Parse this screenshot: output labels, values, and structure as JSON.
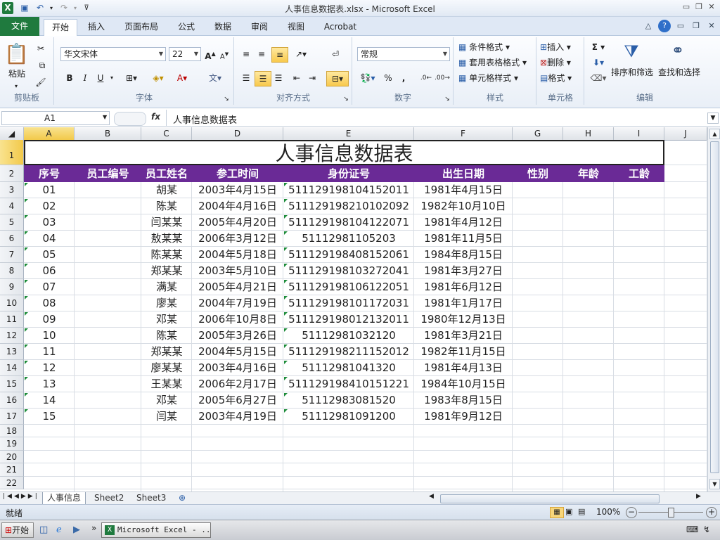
{
  "window": {
    "title": "人事信息数据表.xlsx - Microsoft Excel"
  },
  "tabs": [
    "文件",
    "开始",
    "插入",
    "页面布局",
    "公式",
    "数据",
    "审阅",
    "视图",
    "Acrobat"
  ],
  "ribbon": {
    "clipboard": {
      "label": "剪贴板",
      "paste": "粘贴"
    },
    "font": {
      "label": "字体",
      "name": "华文宋体",
      "size": "22",
      "bold": "B",
      "italic": "I",
      "underline": "U"
    },
    "align": {
      "label": "对齐方式"
    },
    "number": {
      "label": "数字",
      "format": "常规",
      "percent": "%",
      "comma": ","
    },
    "styles": {
      "label": "样式",
      "cond": "条件格式",
      "table": "套用表格格式",
      "cell": "单元格样式"
    },
    "cells": {
      "label": "单元格",
      "insert": "插入",
      "delete": "删除",
      "format": "格式"
    },
    "edit": {
      "label": "编辑",
      "sort": "排序和筛选",
      "find": "查找和选择",
      "sigma": "Σ"
    }
  },
  "formula_bar": {
    "name_box": "A1",
    "fx": "fx",
    "value": "人事信息数据表"
  },
  "sheet": {
    "columns": [
      "A",
      "B",
      "C",
      "D",
      "E",
      "F",
      "G",
      "H",
      "I",
      "J"
    ],
    "title": "人事信息数据表",
    "headers": [
      "序号",
      "员工编号",
      "员工姓名",
      "参工时间",
      "身份证号",
      "出生日期",
      "性别",
      "年龄",
      "工龄"
    ],
    "rows": [
      [
        "01",
        "",
        "胡某",
        "2003年4月15日",
        "511129198104152011",
        "1981年4月15日"
      ],
      [
        "02",
        "",
        "陈某",
        "2004年4月16日",
        "511129198210102092",
        "1982年10月10日"
      ],
      [
        "03",
        "",
        "闫某某",
        "2005年4月20日",
        "511129198104122071",
        "1981年4月12日"
      ],
      [
        "04",
        "",
        "敖某某",
        "2006年3月12日",
        "51112981105203",
        "1981年11月5日"
      ],
      [
        "05",
        "",
        "陈某某",
        "2004年5月18日",
        "511129198408152061",
        "1984年8月15日"
      ],
      [
        "06",
        "",
        "郑某某",
        "2003年5月10日",
        "511129198103272041",
        "1981年3月27日"
      ],
      [
        "07",
        "",
        "满某",
        "2005年4月21日",
        "511129198106122051",
        "1981年6月12日"
      ],
      [
        "08",
        "",
        "廖某",
        "2004年7月19日",
        "511129198101172031",
        "1981年1月17日"
      ],
      [
        "09",
        "",
        "邓某",
        "2006年10月8日",
        "511129198012132011",
        "1980年12月13日"
      ],
      [
        "10",
        "",
        "陈某",
        "2005年3月26日",
        "51112981032120",
        "1981年3月21日"
      ],
      [
        "11",
        "",
        "郑某某",
        "2004年5月15日",
        "511129198211152012",
        "1982年11月15日"
      ],
      [
        "12",
        "",
        "廖某某",
        "2003年4月16日",
        "51112981041320",
        "1981年4月13日"
      ],
      [
        "13",
        "",
        "王某某",
        "2006年2月17日",
        "511129198410151221",
        "1984年10月15日"
      ],
      [
        "14",
        "",
        "邓某",
        "2005年6月27日",
        "51112983081520",
        "1983年8月15日"
      ],
      [
        "15",
        "",
        "闫某",
        "2003年4月19日",
        "51112981091200",
        "1981年9月12日"
      ]
    ],
    "row_numbers": [
      "1",
      "2",
      "3",
      "4",
      "5",
      "6",
      "7",
      "8",
      "9",
      "10",
      "11",
      "12",
      "13",
      "14",
      "15",
      "16",
      "17",
      "18",
      "19",
      "20",
      "21",
      "22"
    ]
  },
  "sheet_tabs": [
    "人事信息",
    "Sheet2",
    "Sheet3"
  ],
  "status": {
    "ready": "就绪",
    "zoom": "100%"
  },
  "taskbar": {
    "start": "开始",
    "task": "Microsoft Excel - ..."
  },
  "colors": {
    "header_bg": "#6a2a96",
    "file_tab": "#1f7a3e",
    "selection": "#f2c94a"
  }
}
